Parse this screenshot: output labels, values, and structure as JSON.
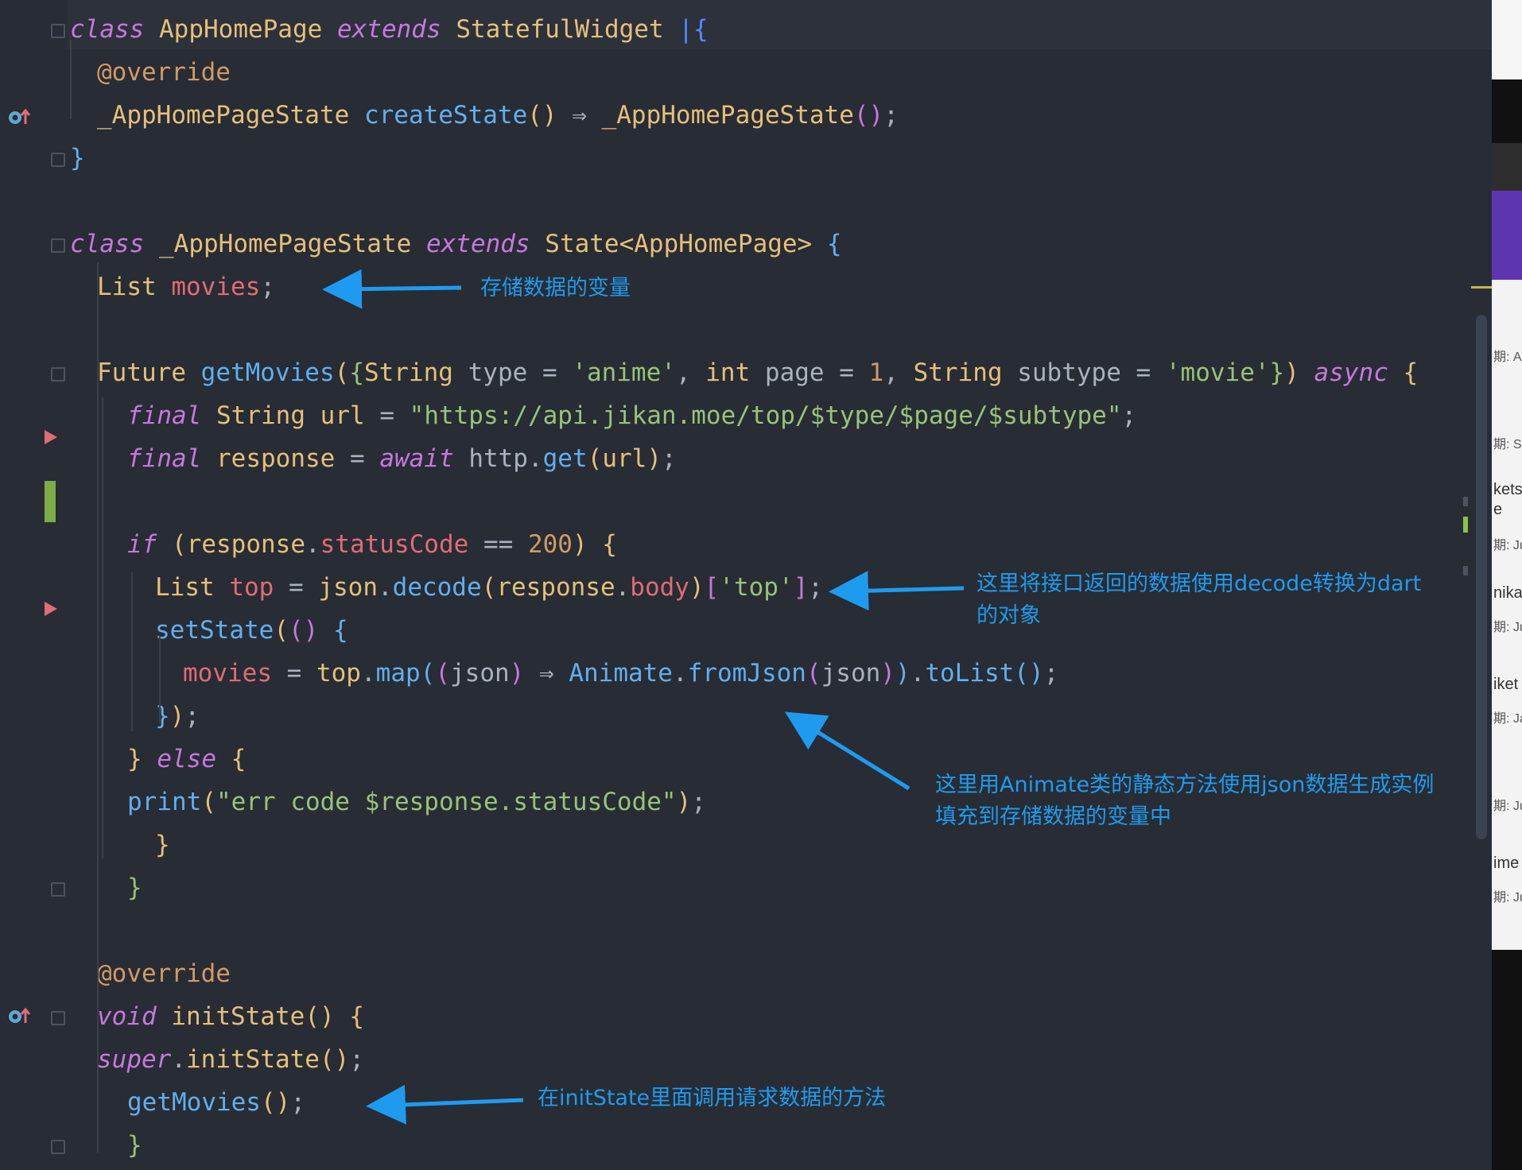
{
  "colors": {
    "background": "#282c34",
    "annotation": "#1e9bef",
    "keyword": "#c678dd",
    "type": "#e5c07b",
    "function": "#61afef",
    "string": "#98c379",
    "number": "#d19a66",
    "variable": "#e06c75"
  },
  "code": {
    "lines": [
      [
        [
          "class",
          "kw"
        ],
        [
          " ",
          "pl"
        ],
        [
          "AppHomePage",
          "type"
        ],
        [
          " ",
          "pl"
        ],
        [
          "extends",
          "kw"
        ],
        [
          " ",
          "pl"
        ],
        [
          "StatefulWidget",
          "type"
        ],
        [
          " ",
          "pl"
        ],
        [
          "|{",
          "cursor"
        ]
      ],
      [
        [
          "@override",
          "anno"
        ]
      ],
      [
        [
          "_AppHomePageState",
          "type"
        ],
        [
          " ",
          "pl"
        ],
        [
          "createState",
          "fn"
        ],
        [
          "()",
          "br1"
        ],
        [
          " ⇒ ",
          "op"
        ],
        [
          "_AppHomePageState",
          "type"
        ],
        [
          "()",
          "br2"
        ],
        [
          ";",
          "pl"
        ]
      ],
      [
        [
          "}",
          "br3"
        ]
      ],
      [],
      [
        [
          "class",
          "kw"
        ],
        [
          " ",
          "pl"
        ],
        [
          "_AppHomePageState",
          "type"
        ],
        [
          " ",
          "pl"
        ],
        [
          "extends",
          "kw"
        ],
        [
          " ",
          "pl"
        ],
        [
          "State<AppHomePage>",
          "type"
        ],
        [
          " ",
          "pl"
        ],
        [
          "{",
          "br3"
        ]
      ],
      [
        [
          "List",
          "type"
        ],
        [
          " ",
          "pl"
        ],
        [
          "movies",
          "var"
        ],
        [
          ";",
          "pl"
        ]
      ],
      [],
      [
        [
          "Future",
          "type"
        ],
        [
          " ",
          "pl"
        ],
        [
          "getMovies",
          "fn"
        ],
        [
          "(",
          "br1"
        ],
        [
          "{",
          "str"
        ],
        [
          "String",
          "type"
        ],
        [
          " type = ",
          "pl"
        ],
        [
          "'anime'",
          "str"
        ],
        [
          ", ",
          "pl"
        ],
        [
          "int",
          "type"
        ],
        [
          " page = ",
          "pl"
        ],
        [
          "1",
          "num"
        ],
        [
          ", ",
          "pl"
        ],
        [
          "String",
          "type"
        ],
        [
          " subtype = ",
          "pl"
        ],
        [
          "'movie'",
          "str"
        ],
        [
          "}",
          "str"
        ],
        [
          ")",
          "br1"
        ],
        [
          " ",
          "pl"
        ],
        [
          "async",
          "kw"
        ],
        [
          " ",
          "pl"
        ],
        [
          "{",
          "br1"
        ]
      ],
      [
        [
          "final",
          "kw"
        ],
        [
          " ",
          "pl"
        ],
        [
          "String",
          "type"
        ],
        [
          " ",
          "pl"
        ],
        [
          "url",
          "type"
        ],
        [
          " = ",
          "op"
        ],
        [
          "\"https://api.jikan.moe/top/$type/$page/$subtype\"",
          "str"
        ],
        [
          ";",
          "pl"
        ]
      ],
      [
        [
          "final",
          "kw"
        ],
        [
          " ",
          "pl"
        ],
        [
          "response",
          "type"
        ],
        [
          " = ",
          "op"
        ],
        [
          "await",
          "kw"
        ],
        [
          " ",
          "pl"
        ],
        [
          "http",
          "pl"
        ],
        [
          ".",
          "pl"
        ],
        [
          "get",
          "fn"
        ],
        [
          "(",
          "br1"
        ],
        [
          "url",
          "type"
        ],
        [
          ")",
          "br1"
        ],
        [
          ";",
          "pl"
        ]
      ],
      [],
      [
        [
          "if",
          "kw"
        ],
        [
          " ",
          "pl"
        ],
        [
          "(",
          "br1"
        ],
        [
          "response",
          "type"
        ],
        [
          ".",
          "pl"
        ],
        [
          "statusCode",
          "var"
        ],
        [
          " == ",
          "op"
        ],
        [
          "200",
          "num"
        ],
        [
          ")",
          "br1"
        ],
        [
          " ",
          "pl"
        ],
        [
          "{",
          "br1"
        ]
      ],
      [
        [
          "List",
          "type"
        ],
        [
          " ",
          "pl"
        ],
        [
          "top",
          "var"
        ],
        [
          " = ",
          "op"
        ],
        [
          "json",
          "type"
        ],
        [
          ".",
          "pl"
        ],
        [
          "decode",
          "fn"
        ],
        [
          "(",
          "br1"
        ],
        [
          "response",
          "type"
        ],
        [
          ".",
          "pl"
        ],
        [
          "body",
          "var"
        ],
        [
          ")",
          "br1"
        ],
        [
          "[",
          "br2"
        ],
        [
          "'top'",
          "str"
        ],
        [
          "]",
          "br2"
        ],
        [
          ";",
          "pl"
        ]
      ],
      [
        [
          "setState",
          "fn"
        ],
        [
          "(",
          "br1"
        ],
        [
          "()",
          "br2"
        ],
        [
          " ",
          "pl"
        ],
        [
          "{",
          "br3"
        ]
      ],
      [
        [
          "movies",
          "var"
        ],
        [
          " = ",
          "op"
        ],
        [
          "top",
          "type"
        ],
        [
          ".",
          "pl"
        ],
        [
          "map",
          "fn"
        ],
        [
          "(",
          "br3"
        ],
        [
          "(",
          "br2"
        ],
        [
          "json",
          "pl"
        ],
        [
          ")",
          "br2"
        ],
        [
          " ⇒ ",
          "op"
        ],
        [
          "Animate",
          "fn"
        ],
        [
          ".",
          "pl"
        ],
        [
          "fromJson",
          "fn"
        ],
        [
          "(",
          "br2"
        ],
        [
          "json",
          "pl"
        ],
        [
          ")",
          "br2"
        ],
        [
          ")",
          "br3"
        ],
        [
          ".",
          "pl"
        ],
        [
          "toList",
          "fn"
        ],
        [
          "()",
          "br3"
        ],
        [
          ";",
          "pl"
        ]
      ],
      [
        [
          "}",
          "br3"
        ],
        [
          ")",
          "br1"
        ],
        [
          ";",
          "pl"
        ]
      ],
      [
        [
          "}",
          "br1"
        ],
        [
          " ",
          "pl"
        ],
        [
          "else",
          "kw"
        ],
        [
          " ",
          "pl"
        ],
        [
          "{",
          "br1"
        ]
      ],
      [
        [
          "print",
          "fn"
        ],
        [
          "(",
          "br1"
        ],
        [
          "\"err code $response.statusCode\"",
          "str"
        ],
        [
          ")",
          "br1"
        ],
        [
          ";",
          "pl"
        ]
      ],
      [
        [
          "}",
          "br1"
        ]
      ],
      [
        [
          "}",
          "str"
        ]
      ],
      [],
      [
        [
          "@override",
          "anno"
        ]
      ],
      [
        [
          "void",
          "kw"
        ],
        [
          " ",
          "pl"
        ],
        [
          "initState",
          "type"
        ],
        [
          "()",
          "br1"
        ],
        [
          " ",
          "pl"
        ],
        [
          "{",
          "br1"
        ]
      ],
      [
        [
          "super",
          "kw"
        ],
        [
          ".",
          "pl"
        ],
        [
          "initState",
          "type"
        ],
        [
          "()",
          "br1"
        ],
        [
          ";",
          "pl"
        ]
      ],
      [
        [
          "getMovies",
          "fn"
        ],
        [
          "()",
          "br1"
        ],
        [
          ";",
          "pl"
        ]
      ],
      [
        [
          "}",
          "str"
        ]
      ]
    ]
  },
  "annotations": {
    "movies_var": "存储数据的变量",
    "decode_line1": "这里将接口返回的数据使用decode转换为dart",
    "decode_line2": "的对象",
    "fromjson_line1": "这里用Animate类的静态方法使用json数据生成实例",
    "fromjson_line2": "填充到存储数据的变量中",
    "initstate": "在initState里面调用请求数据的方法"
  },
  "right_panel": {
    "items": [
      "期: Au",
      "期: Se",
      "kets",
      "e",
      "期: Jul",
      "nikal",
      "期: Jul",
      "iket",
      "期: Ja",
      "期: Jul",
      "ime",
      "期: Jul"
    ]
  }
}
